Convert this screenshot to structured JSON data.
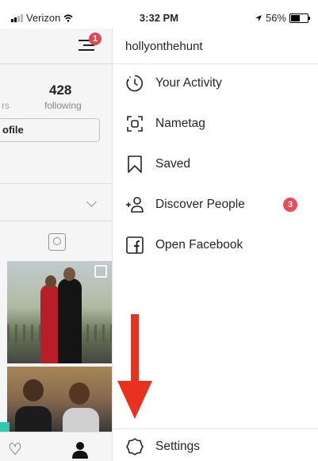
{
  "status_bar": {
    "carrier": "Verizon",
    "time": "3:32 PM",
    "battery": "56%",
    "battery_level": 0.56
  },
  "profile": {
    "notification_count": "1",
    "followers_partial": "rs",
    "following_count": "428",
    "following_label": "following",
    "edit_profile_partial": "ofile"
  },
  "menu": {
    "username": "hollyonthehunt",
    "items": [
      {
        "label": "Your Activity",
        "icon": "activity-clock-icon"
      },
      {
        "label": "Nametag",
        "icon": "nametag-icon"
      },
      {
        "label": "Saved",
        "icon": "bookmark-icon"
      },
      {
        "label": "Discover People",
        "icon": "add-person-icon",
        "badge": "3"
      },
      {
        "label": "Open Facebook",
        "icon": "facebook-icon"
      }
    ],
    "settings_label": "Settings"
  },
  "colors": {
    "badge": "#ed4956",
    "annotation_arrow": "#e8321e",
    "teal": "#2ed3b5"
  }
}
